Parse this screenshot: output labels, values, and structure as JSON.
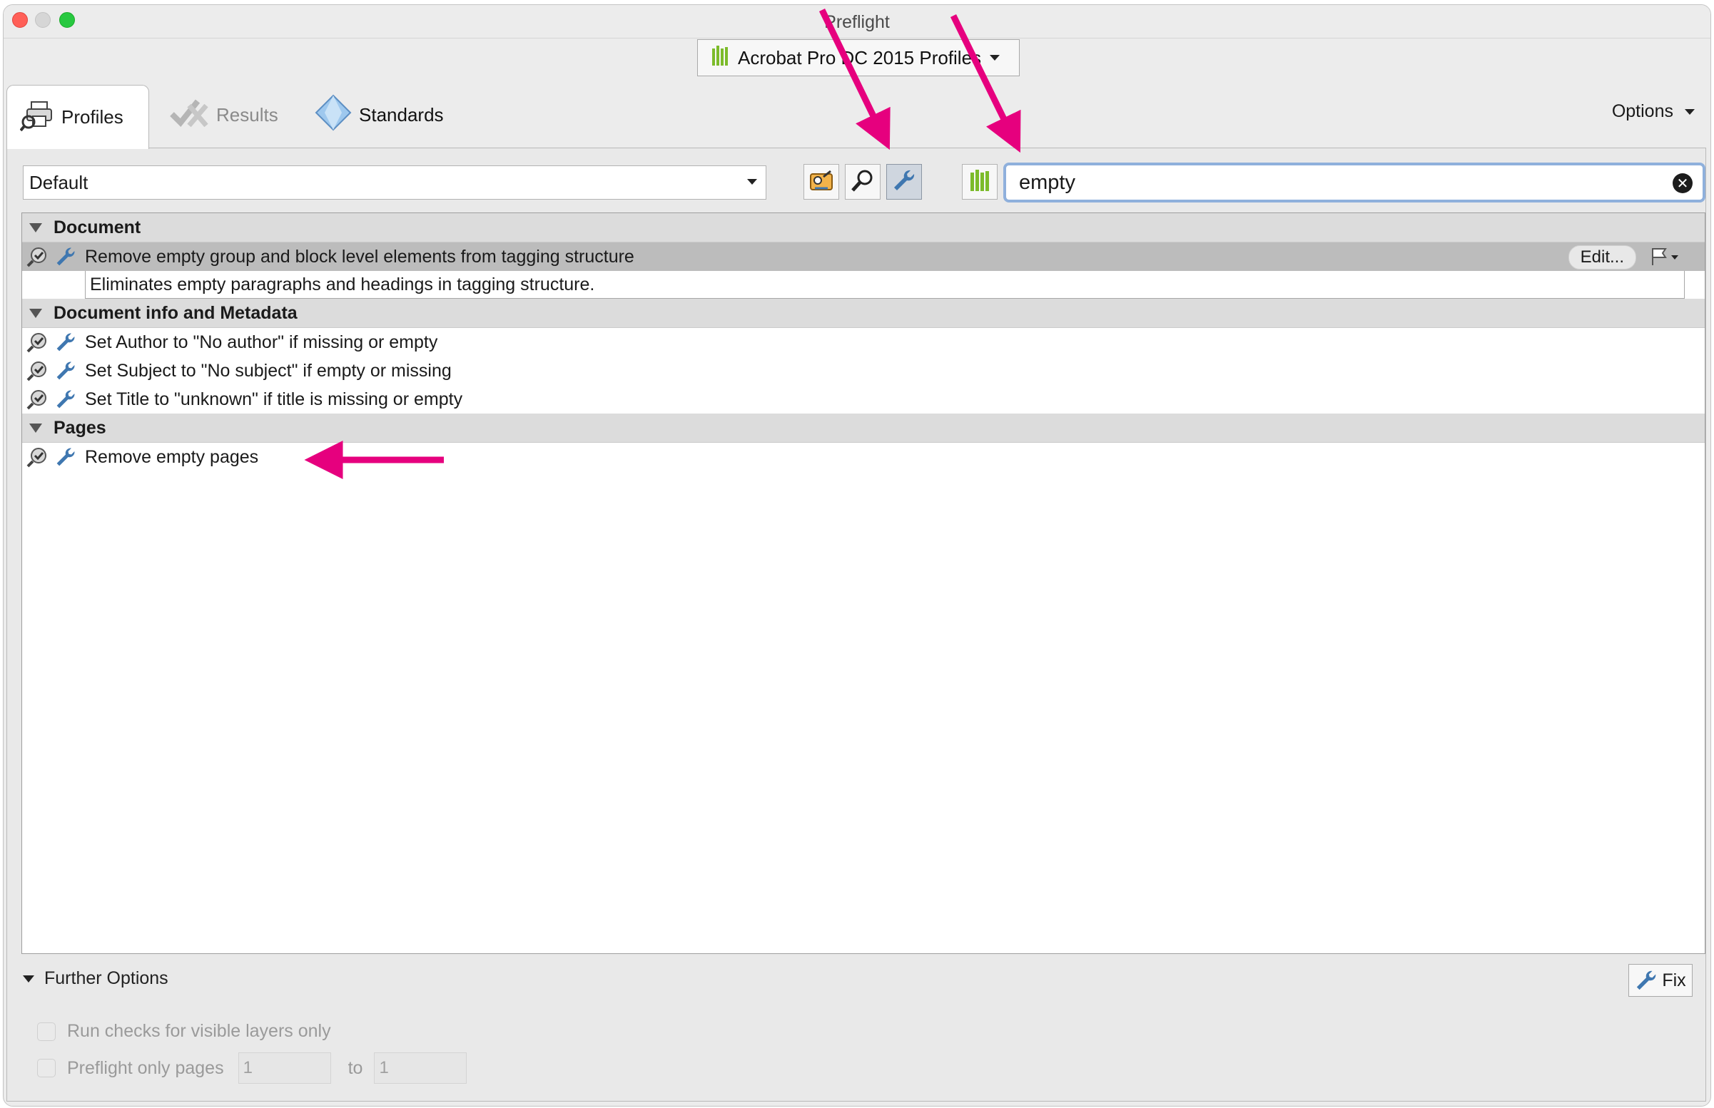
{
  "window": {
    "title": "Preflight"
  },
  "profile_set": {
    "label": "Acrobat Pro DC 2015 Profiles"
  },
  "tabs": [
    {
      "label": "Profiles"
    },
    {
      "label": "Results"
    },
    {
      "label": "Standards"
    }
  ],
  "options": {
    "label": "Options"
  },
  "profile_select": {
    "value": "Default"
  },
  "search": {
    "value": "empty"
  },
  "list": {
    "groups": [
      {
        "name": "Document",
        "items": [
          {
            "label": "Remove empty group and block level elements from tagging structure",
            "description": "Eliminates empty paragraphs and headings in tagging structure.",
            "edit_label": "Edit..."
          }
        ]
      },
      {
        "name": "Document info and Metadata",
        "items": [
          {
            "label": "Set Author to \"No author\" if missing or empty"
          },
          {
            "label": "Set Subject to \"No subject\" if empty or missing"
          },
          {
            "label": "Set Title to \"unknown\" if title is missing or empty"
          }
        ]
      },
      {
        "name": "Pages",
        "items": [
          {
            "label": "Remove empty pages"
          }
        ]
      }
    ]
  },
  "further_options": {
    "label": "Further Options",
    "fix_label": "Fix",
    "visible_layers_label": "Run checks for visible layers only",
    "pages_label": "Preflight only pages",
    "page_from": "1",
    "to_label": "to",
    "page_to": "1"
  },
  "colors": {
    "annotation_arrow": "#e6007e",
    "fixup_icon": "#3f77b0",
    "library_icon": "#7cbb2a"
  }
}
